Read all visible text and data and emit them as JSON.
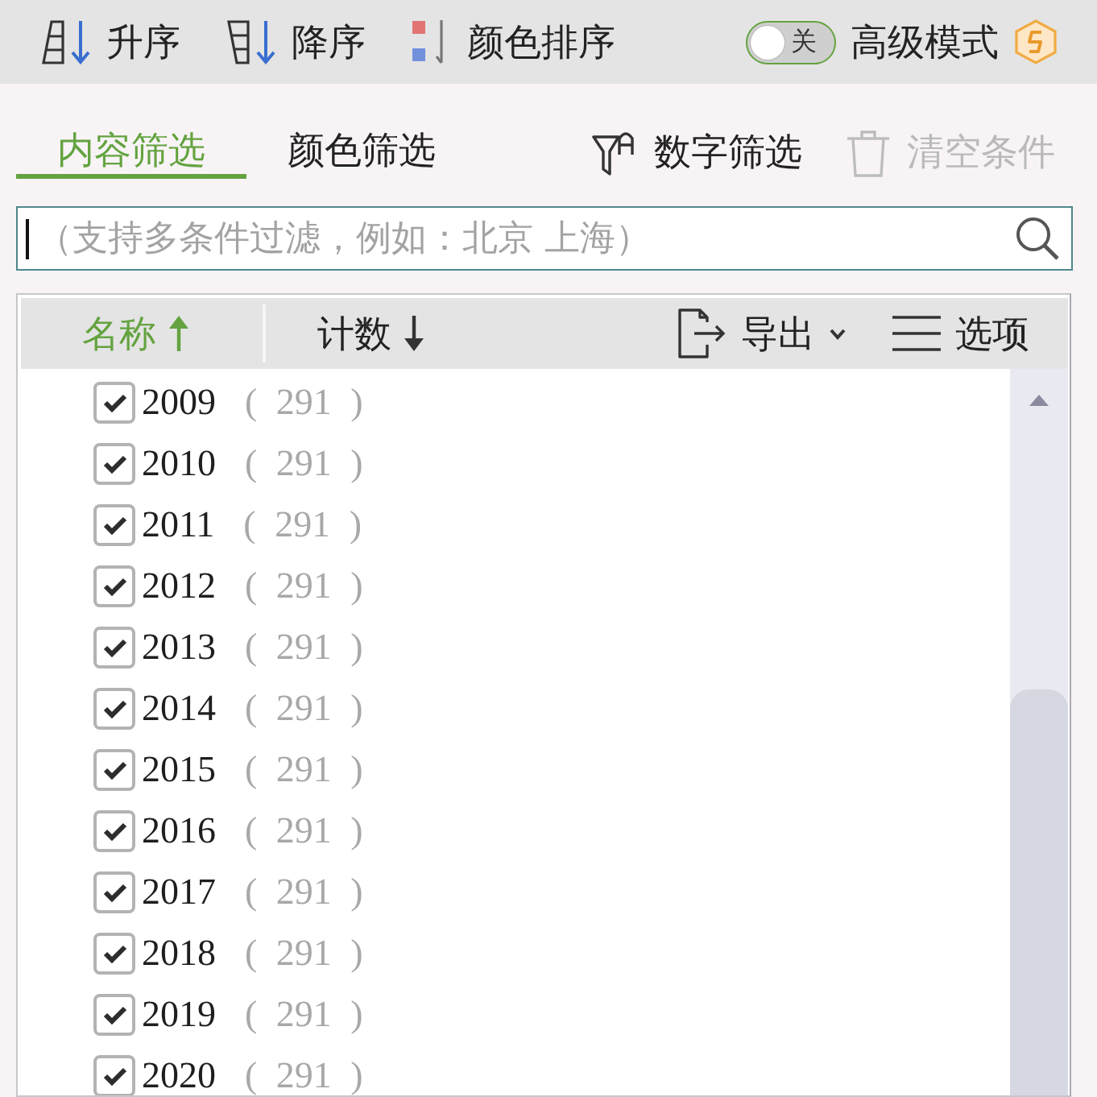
{
  "toolbar": {
    "sort_buttons": [
      {
        "kind": "ascending",
        "label": "升序"
      },
      {
        "kind": "descending",
        "label": "降序"
      },
      {
        "kind": "color",
        "label": "颜色排序"
      }
    ],
    "advanced_mode": {
      "switch_label": "关",
      "on": false,
      "label": "高级模式"
    }
  },
  "tabs": [
    {
      "label": "内容筛选",
      "selected": true
    },
    {
      "label": "颜色筛选",
      "selected": false
    }
  ],
  "actions": [
    {
      "kind": "number-filter",
      "label": "数字筛选",
      "disabled": false
    },
    {
      "kind": "clear",
      "label": "清空条件",
      "disabled": true
    }
  ],
  "search": {
    "placeholder": "（支持多条件过滤，例如：北京 上海）",
    "focused": true
  },
  "list": {
    "columns": [
      {
        "label": "名称",
        "kind": "ascending",
        "selected": true
      },
      {
        "label": "计数",
        "kind": "descending",
        "selected": false
      }
    ],
    "export": {
      "label": "导出"
    },
    "options": {
      "label": "选项"
    },
    "items": [
      {
        "name": "2009",
        "count": "( 291 )",
        "checked": true
      },
      {
        "name": "2010",
        "count": "( 291 )",
        "checked": true
      },
      {
        "name": "2011",
        "count": "( 291 )",
        "checked": true
      },
      {
        "name": "2012",
        "count": "( 291 )",
        "checked": true
      },
      {
        "name": "2013",
        "count": "( 291 )",
        "checked": true
      },
      {
        "name": "2014",
        "count": "( 291 )",
        "checked": true
      },
      {
        "name": "2015",
        "count": "( 291 )",
        "checked": true
      },
      {
        "name": "2016",
        "count": "( 291 )",
        "checked": true
      },
      {
        "name": "2017",
        "count": "( 291 )",
        "checked": true
      },
      {
        "name": "2018",
        "count": "( 291 )",
        "checked": true
      },
      {
        "name": "2019",
        "count": "( 291 )",
        "checked": true
      },
      {
        "name": "2020",
        "count": "( 291 )",
        "checked": true
      }
    ]
  }
}
